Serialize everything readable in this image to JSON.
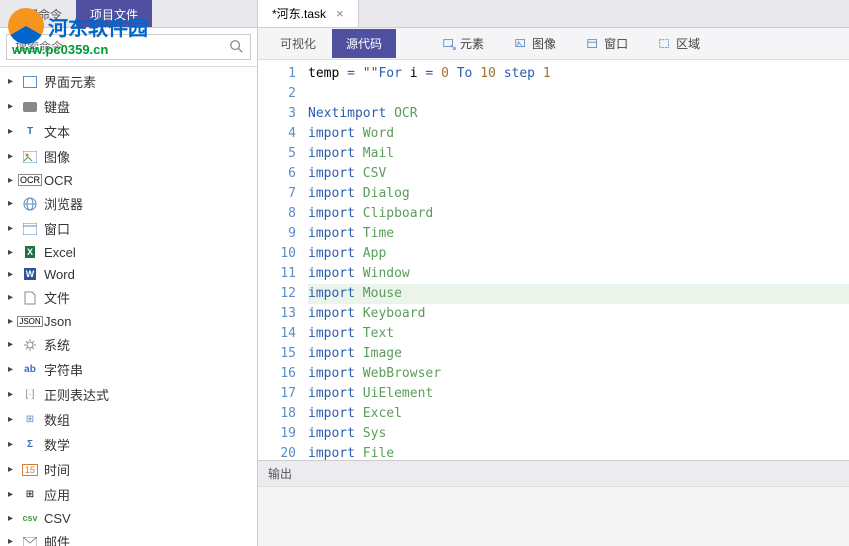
{
  "watermark": {
    "text": "河东软件园",
    "url": "www.pc0359.cn"
  },
  "sidebar": {
    "tabs": [
      "全部命令",
      "项目文件"
    ],
    "activeTab": 1,
    "searchPlaceholder": "搜索命令",
    "items": [
      {
        "icon": "ui",
        "label": "界面元素"
      },
      {
        "icon": "keyboard",
        "label": "键盘"
      },
      {
        "icon": "text",
        "label": "文本"
      },
      {
        "icon": "image",
        "label": "图像"
      },
      {
        "icon": "ocr",
        "label": "OCR"
      },
      {
        "icon": "browser",
        "label": "浏览器"
      },
      {
        "icon": "window",
        "label": "窗口"
      },
      {
        "icon": "excel",
        "label": "Excel"
      },
      {
        "icon": "word",
        "label": "Word"
      },
      {
        "icon": "file",
        "label": "文件"
      },
      {
        "icon": "json",
        "label": "Json"
      },
      {
        "icon": "system",
        "label": "系统"
      },
      {
        "icon": "string",
        "label": "字符串"
      },
      {
        "icon": "regex",
        "label": "正则表达式"
      },
      {
        "icon": "array",
        "label": "数组"
      },
      {
        "icon": "math",
        "label": "数学"
      },
      {
        "icon": "time",
        "label": "时间"
      },
      {
        "icon": "app",
        "label": "应用"
      },
      {
        "icon": "csv",
        "label": "CSV"
      },
      {
        "icon": "mail",
        "label": "邮件"
      }
    ]
  },
  "fileTab": {
    "name": "*河东.task"
  },
  "viewTabs": [
    "可视化",
    "源代码"
  ],
  "activeViewTab": 1,
  "tools": [
    {
      "icon": "element",
      "label": "元素"
    },
    {
      "icon": "image",
      "label": "图像"
    },
    {
      "icon": "window",
      "label": "窗口"
    },
    {
      "icon": "region",
      "label": "区域"
    }
  ],
  "code": {
    "lines": [
      {
        "n": 1,
        "tokens": [
          {
            "t": "temp ",
            "c": ""
          },
          {
            "t": "=",
            "c": "kw"
          },
          {
            "t": " ",
            "c": ""
          },
          {
            "t": "\"\"",
            "c": "str"
          },
          {
            "t": "For",
            "c": "kw"
          },
          {
            "t": " i ",
            "c": ""
          },
          {
            "t": "=",
            "c": "kw"
          },
          {
            "t": " ",
            "c": ""
          },
          {
            "t": "0",
            "c": "num"
          },
          {
            "t": " To ",
            "c": "kw"
          },
          {
            "t": "10",
            "c": "num"
          },
          {
            "t": " step ",
            "c": "kw"
          },
          {
            "t": "1",
            "c": "num"
          }
        ]
      },
      {
        "n": 2,
        "tokens": []
      },
      {
        "n": 3,
        "tokens": [
          {
            "t": "Next",
            "c": "kw"
          },
          {
            "t": "import",
            "c": "kw2"
          },
          {
            "t": " ",
            "c": ""
          },
          {
            "t": "OCR",
            "c": "ident"
          }
        ]
      },
      {
        "n": 4,
        "tokens": [
          {
            "t": "import",
            "c": "kw2"
          },
          {
            "t": " ",
            "c": ""
          },
          {
            "t": "Word",
            "c": "ident"
          }
        ]
      },
      {
        "n": 5,
        "tokens": [
          {
            "t": "import",
            "c": "kw2"
          },
          {
            "t": " ",
            "c": ""
          },
          {
            "t": "Mail",
            "c": "ident"
          }
        ]
      },
      {
        "n": 6,
        "tokens": [
          {
            "t": "import",
            "c": "kw2"
          },
          {
            "t": " ",
            "c": ""
          },
          {
            "t": "CSV",
            "c": "ident"
          }
        ]
      },
      {
        "n": 7,
        "tokens": [
          {
            "t": "import",
            "c": "kw2"
          },
          {
            "t": " ",
            "c": ""
          },
          {
            "t": "Dialog",
            "c": "ident"
          }
        ]
      },
      {
        "n": 8,
        "tokens": [
          {
            "t": "import",
            "c": "kw2"
          },
          {
            "t": " ",
            "c": ""
          },
          {
            "t": "Clipboard",
            "c": "ident"
          }
        ]
      },
      {
        "n": 9,
        "tokens": [
          {
            "t": "import",
            "c": "kw2"
          },
          {
            "t": " ",
            "c": ""
          },
          {
            "t": "Time",
            "c": "ident"
          }
        ]
      },
      {
        "n": 10,
        "tokens": [
          {
            "t": "import",
            "c": "kw2"
          },
          {
            "t": " ",
            "c": ""
          },
          {
            "t": "App",
            "c": "ident"
          }
        ]
      },
      {
        "n": 11,
        "tokens": [
          {
            "t": "import",
            "c": "kw2"
          },
          {
            "t": " ",
            "c": ""
          },
          {
            "t": "Window",
            "c": "ident"
          }
        ]
      },
      {
        "n": 12,
        "tokens": [
          {
            "t": "import",
            "c": "kw2"
          },
          {
            "t": " ",
            "c": ""
          },
          {
            "t": "Mouse",
            "c": "ident"
          }
        ],
        "highlight": true
      },
      {
        "n": 13,
        "tokens": [
          {
            "t": "import",
            "c": "kw2"
          },
          {
            "t": " ",
            "c": ""
          },
          {
            "t": "Keyboard",
            "c": "ident"
          }
        ]
      },
      {
        "n": 14,
        "tokens": [
          {
            "t": "import",
            "c": "kw2"
          },
          {
            "t": " ",
            "c": ""
          },
          {
            "t": "Text",
            "c": "ident"
          }
        ]
      },
      {
        "n": 15,
        "tokens": [
          {
            "t": "import",
            "c": "kw2"
          },
          {
            "t": " ",
            "c": ""
          },
          {
            "t": "Image",
            "c": "ident"
          }
        ]
      },
      {
        "n": 16,
        "tokens": [
          {
            "t": "import",
            "c": "kw2"
          },
          {
            "t": " ",
            "c": ""
          },
          {
            "t": "WebBrowser",
            "c": "ident"
          }
        ]
      },
      {
        "n": 17,
        "tokens": [
          {
            "t": "import",
            "c": "kw2"
          },
          {
            "t": " ",
            "c": ""
          },
          {
            "t": "UiElement",
            "c": "ident"
          }
        ]
      },
      {
        "n": 18,
        "tokens": [
          {
            "t": "import",
            "c": "kw2"
          },
          {
            "t": " ",
            "c": ""
          },
          {
            "t": "Excel",
            "c": "ident"
          }
        ]
      },
      {
        "n": 19,
        "tokens": [
          {
            "t": "import",
            "c": "kw2"
          },
          {
            "t": " ",
            "c": ""
          },
          {
            "t": "Sys",
            "c": "ident"
          }
        ]
      },
      {
        "n": 20,
        "tokens": [
          {
            "t": "import",
            "c": "kw2"
          },
          {
            "t": " ",
            "c": ""
          },
          {
            "t": "File",
            "c": "ident"
          }
        ]
      }
    ]
  },
  "outputPanel": {
    "title": "输出"
  }
}
